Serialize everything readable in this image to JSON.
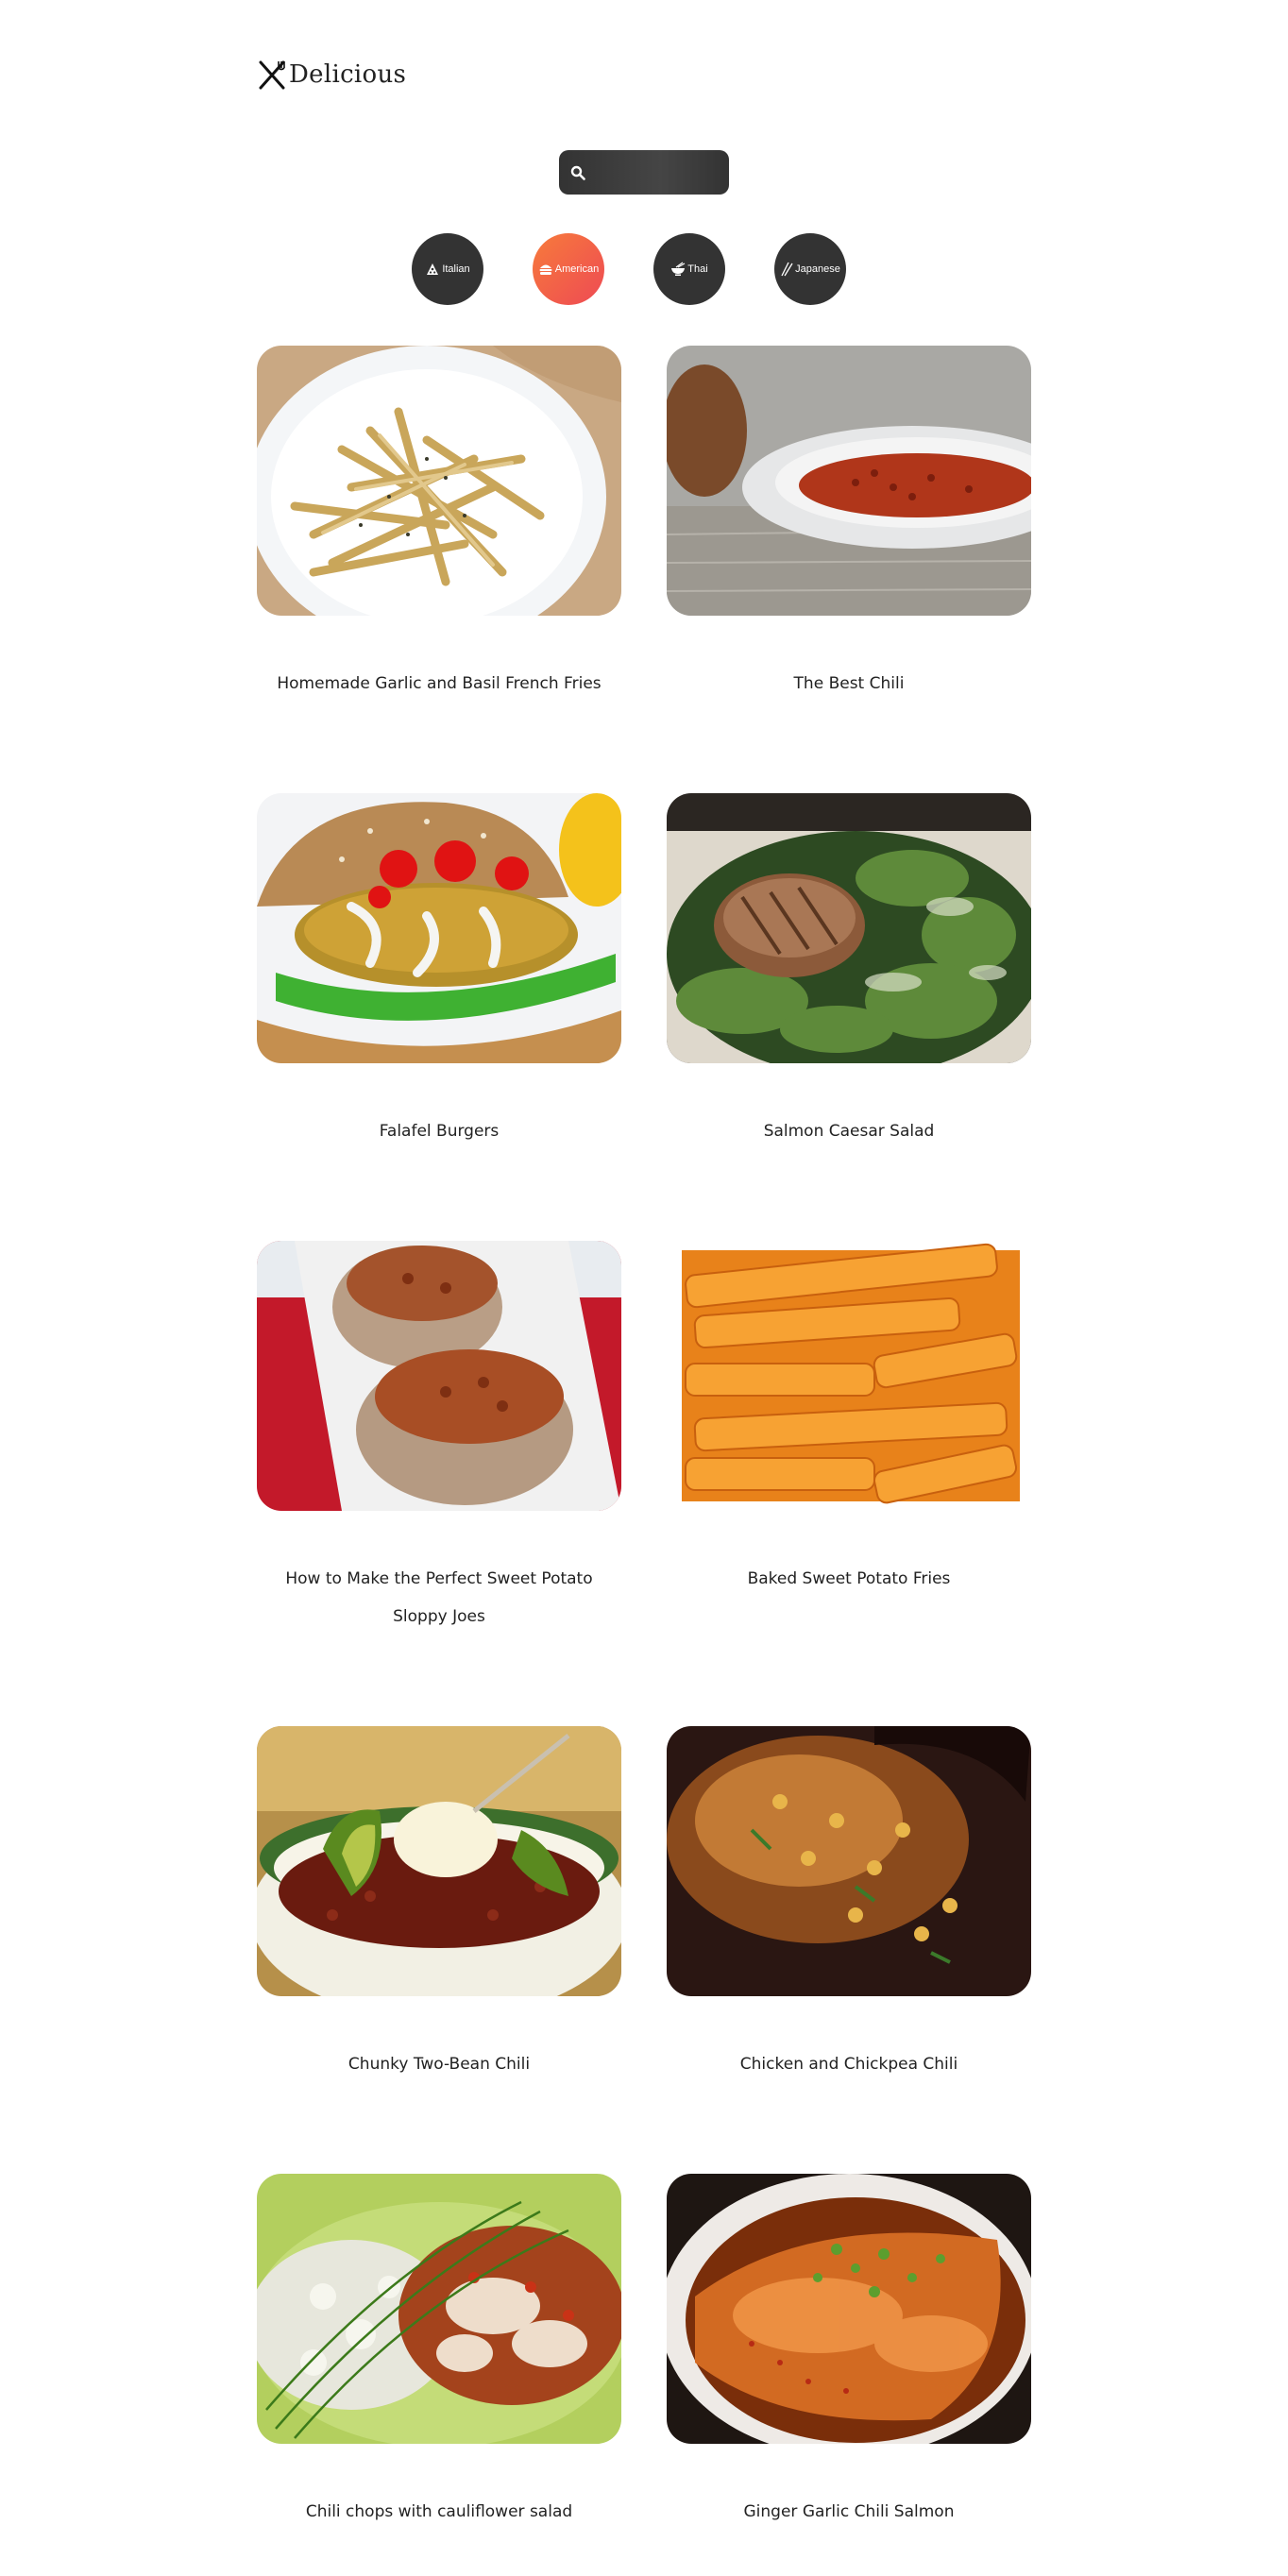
{
  "header": {
    "logo_text": "Delicious",
    "logo_icon": "fork-knife-icon"
  },
  "search": {
    "icon": "search-icon",
    "placeholder": "",
    "value": ""
  },
  "categories": [
    {
      "label": "Italian",
      "icon": "pizza-icon",
      "active": false
    },
    {
      "label": "American",
      "icon": "burger-icon",
      "active": true
    },
    {
      "label": "Thai",
      "icon": "noodle-bowl-icon",
      "active": false
    },
    {
      "label": "Japanese",
      "icon": "chopsticks-icon",
      "active": false
    }
  ],
  "recipes": [
    {
      "title": "Homemade Garlic and Basil French Fries"
    },
    {
      "title": "The Best Chili"
    },
    {
      "title": "Falafel Burgers"
    },
    {
      "title": "Salmon Caesar Salad"
    },
    {
      "title": "How to Make the Perfect Sweet Potato Sloppy Joes"
    },
    {
      "title": "Baked Sweet Potato Fries"
    },
    {
      "title": "Chunky Two-Bean Chili"
    },
    {
      "title": "Chicken and Chickpea Chili"
    },
    {
      "title": "Chili chops with cauliflower salad"
    },
    {
      "title": "Ginger Garlic Chili Salmon"
    }
  ],
  "colors": {
    "active_gradient_start": "#f77b3b",
    "active_gradient_end": "#ee4a54",
    "button_dark": "#333333"
  }
}
